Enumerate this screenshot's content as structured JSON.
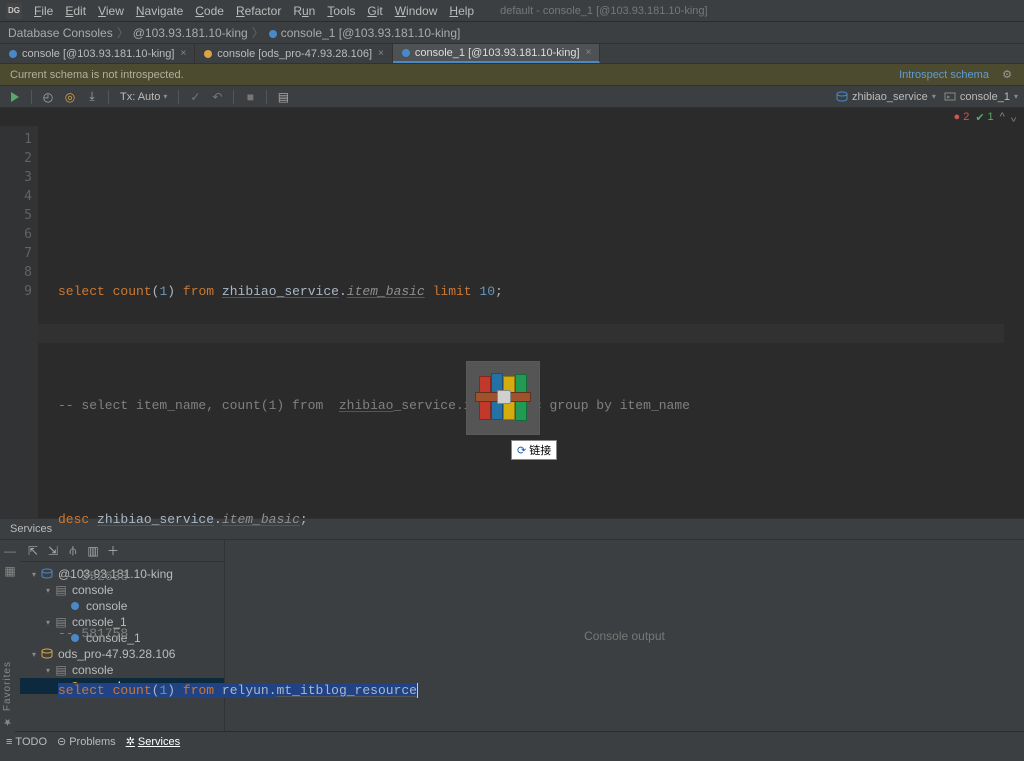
{
  "menu": {
    "file": "File",
    "edit": "Edit",
    "view": "View",
    "navigate": "Navigate",
    "code": "Code",
    "refactor": "Refactor",
    "run": "Run",
    "tools": "Tools",
    "git": "Git",
    "window": "Window",
    "help": "Help"
  },
  "window_title": "default - console_1 [@103.93.181.10-king]",
  "breadcrumb": {
    "a": "Database Consoles",
    "b": "@103.93.181.10-king",
    "c": "console_1 [@103.93.181.10-king]"
  },
  "tabs": [
    {
      "label": "console [@103.93.181.10-king]",
      "active": false
    },
    {
      "label": "console [ods_pro-47.93.28.106]",
      "active": false
    },
    {
      "label": "console_1 [@103.93.181.10-king]",
      "active": true
    }
  ],
  "notice": {
    "text": "Current schema is not introspected.",
    "link": "Introspect schema"
  },
  "editor_toolbar": {
    "tx": "Tx: Auto",
    "schema": "zhibiao_service",
    "console": "console_1"
  },
  "warnings": {
    "errors": "2",
    "ok": "1"
  },
  "gutter_lines": [
    "1",
    "2",
    "3",
    "4",
    "5",
    "6",
    "7",
    "8",
    "9"
  ],
  "code": {
    "l2": {
      "select": "select",
      "count": "count",
      "p1": "(",
      "n1": "1",
      "p2": ")",
      "from": "from",
      "schema": "zhibiao_service",
      "dot": ".",
      "table": "item_basic",
      "limit": "limit",
      "n10": "10",
      "semi": ";"
    },
    "l4": "-- select item_name, count(1) from  zhibiao_service.item_basic group by item_name",
    "l4_parts": {
      "pre": "-- select item_name, count(1) from  ",
      "schema": "zhibiao",
      "rest": "_service.item_basic group by item_name"
    },
    "l6": {
      "desc": "desc ",
      "schema": "zhibiao_service",
      "dot": ".",
      "table": "item_basic",
      "semi": ";"
    },
    "l7": "-- 552638",
    "l8": "-- 581758",
    "l9": {
      "select": "select",
      "count": "count",
      "p1": "(",
      "n1": "1",
      "p2": ")",
      "from": "from",
      "schema": "relyun",
      "dot": ".",
      "table": "mt_itblog_resource"
    }
  },
  "drag_tooltip": "链接",
  "services": {
    "title": "Services",
    "tree": {
      "root": "@103.93.181.10-king",
      "c1": "console",
      "c1a": "console",
      "c2": "console_1",
      "c2a": "console_1",
      "root2": "ods_pro-47.93.28.106",
      "r2c": "console",
      "r2ca": "console"
    },
    "main": "Console output"
  },
  "bottom": {
    "todo": "TODO",
    "problems": "Problems",
    "services": "Services"
  },
  "sidefav": "Favorites"
}
